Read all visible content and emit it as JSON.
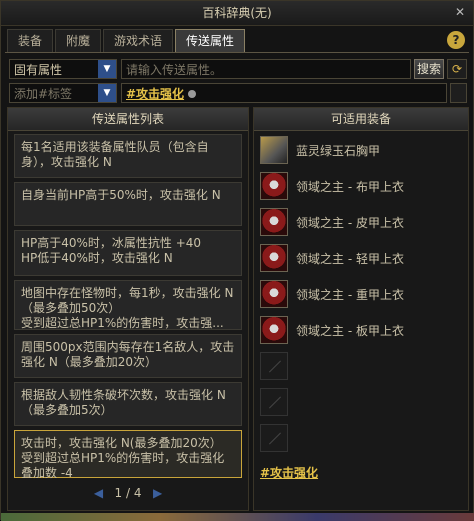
{
  "window": {
    "title": "百科辞典(无)"
  },
  "tabs": [
    "装备",
    "附魔",
    "游戏术语",
    "传送属性"
  ],
  "active_tab": 3,
  "filters": {
    "category_value": "固有属性",
    "search_placeholder": "请输入传送属性。",
    "search_button": "搜索",
    "tag_placeholder": "添加#标签",
    "active_tag": "#攻击强化"
  },
  "left_panel": {
    "header": "传送属性列表",
    "items": [
      "每1名适用该装备属性队员（包含自身），攻击强化 N",
      "自身当前HP高于50%时，攻击强化 N",
      "HP高于40%时，冰属性抗性 +40\nHP低于40%时，攻击强化 N",
      "地图中存在怪物时，每1秒，攻击强化 N（最多叠加50次）\n受到超过总HP1%的伤害时，攻击强...",
      "周围500px范围内每存在1名敌人，攻击强化 N（最多叠加20次）",
      "根据敌人韧性条破坏次数，攻击强化 N（最多叠加5次）",
      "攻击时，攻击强化 N(最多叠加20次）\n受到超过总HP1%的伤害时，攻击强化叠加数 -4"
    ],
    "pager": {
      "current": "1",
      "total": "4",
      "separator": "/"
    }
  },
  "right_panel": {
    "header": "可适用装备",
    "items": [
      {
        "name": "蓝灵绿玉石胸甲",
        "icon": "armor-icon"
      },
      {
        "name": "领域之主 - 布甲上衣",
        "icon": "armor-icon"
      },
      {
        "name": "领域之主 - 皮甲上衣",
        "icon": "armor-icon"
      },
      {
        "name": "领域之主 - 轻甲上衣",
        "icon": "armor-icon"
      },
      {
        "name": "领域之主 - 重甲上衣",
        "icon": "armor-icon"
      },
      {
        "name": "领域之主 - 板甲上衣",
        "icon": "armor-icon"
      }
    ],
    "tag_footer": "#攻击强化"
  },
  "colors": {
    "accent": "#c9a53a",
    "tag": "#e6c349",
    "dropdown": "#2e4f8a"
  }
}
